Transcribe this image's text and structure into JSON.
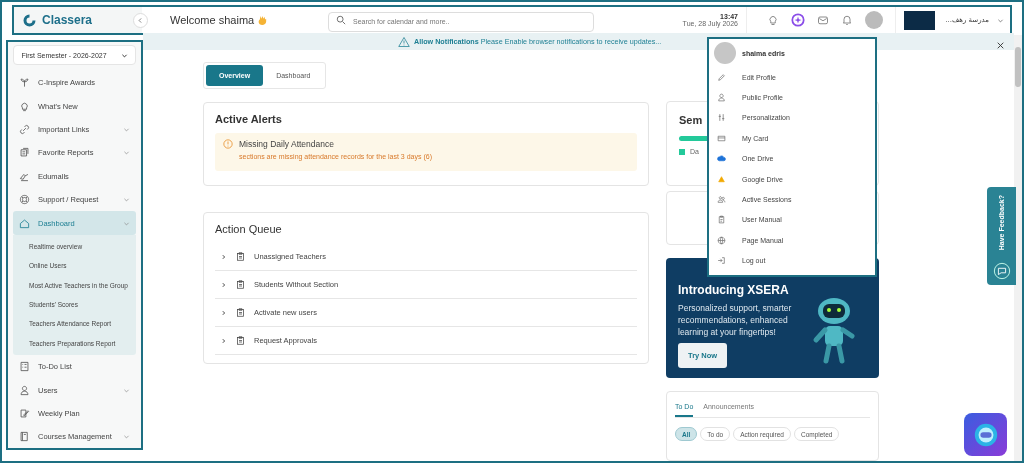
{
  "header": {
    "logo": "Classera",
    "welcome": "Welcome shaima",
    "search": {
      "placeholder": "Search for calendar and more.."
    },
    "time": "13:47",
    "date": "Tue, 28 July 2026",
    "school": "مدرسة رهف..."
  },
  "sidebar": {
    "semester": "First Semester - 2026-2027",
    "items": [
      {
        "label": "C-Inspire Awards",
        "selected": false,
        "kind": "link"
      },
      {
        "label": "What's New",
        "selected": false,
        "kind": "link"
      },
      {
        "label": "Important Links",
        "selected": false,
        "kind": "group"
      },
      {
        "label": "Favorite Reports",
        "selected": false,
        "kind": "group"
      },
      {
        "label": "Edumalls",
        "selected": false,
        "kind": "link"
      },
      {
        "label": "Support / Request",
        "selected": false,
        "kind": "group"
      },
      {
        "label": "Dashboard",
        "selected": true,
        "kind": "group",
        "children": [
          "Realtime overview",
          "Online Users",
          "Most Active Teachers in the Group",
          "Students' Scores",
          "Teachers Attendance Report",
          "Teachers Preparations Report"
        ]
      },
      {
        "label": "To-Do List",
        "selected": false,
        "kind": "link"
      },
      {
        "label": "Users",
        "selected": false,
        "kind": "group"
      },
      {
        "label": "Weekly Plan",
        "selected": false,
        "kind": "link"
      },
      {
        "label": "Courses Management",
        "selected": false,
        "kind": "group"
      }
    ]
  },
  "notification": "**Allow Notifications** Please Enable browser notifications to receive updates...",
  "tabs": [
    {
      "label": "Overview",
      "selected": true
    },
    {
      "label": "Dashboard",
      "selected": false
    }
  ],
  "alerts": {
    "title": "Active Alerts",
    "items": [
      {
        "title": "Missing Daily Attendance",
        "detail": "sections are missing attendance records for the last 3 days (6)"
      }
    ]
  },
  "action_queue": {
    "title": "Action Queue",
    "items": [
      "Unassigned Teachers",
      "Students Without Section",
      "Activate new users",
      "Request Approvals"
    ]
  },
  "semester_card": {
    "title": "Sem",
    "legend": "Da"
  },
  "xsera": {
    "title": "Introducing XSERA",
    "text": "Personalized support, smarter recommendations, enhanced learning at your fingertips!",
    "button": "Try Now"
  },
  "todo": {
    "tabs": [
      {
        "label": "To Do",
        "selected": true
      },
      {
        "label": "Announcements",
        "selected": false
      }
    ],
    "filters": [
      {
        "label": "All",
        "selected": true
      },
      {
        "label": "To do",
        "selected": false
      },
      {
        "label": "Action required",
        "selected": false
      },
      {
        "label": "Completed",
        "selected": false
      }
    ]
  },
  "user_menu": {
    "name": "shaima edris",
    "items": [
      "Edit Profile",
      "Public Profile",
      "Personalization",
      "My Card",
      "One Drive",
      "Google Drive",
      "Active Sessions",
      "User Manual",
      "Page Manual",
      "Log out"
    ]
  },
  "feedback": "Have Feedback?"
}
